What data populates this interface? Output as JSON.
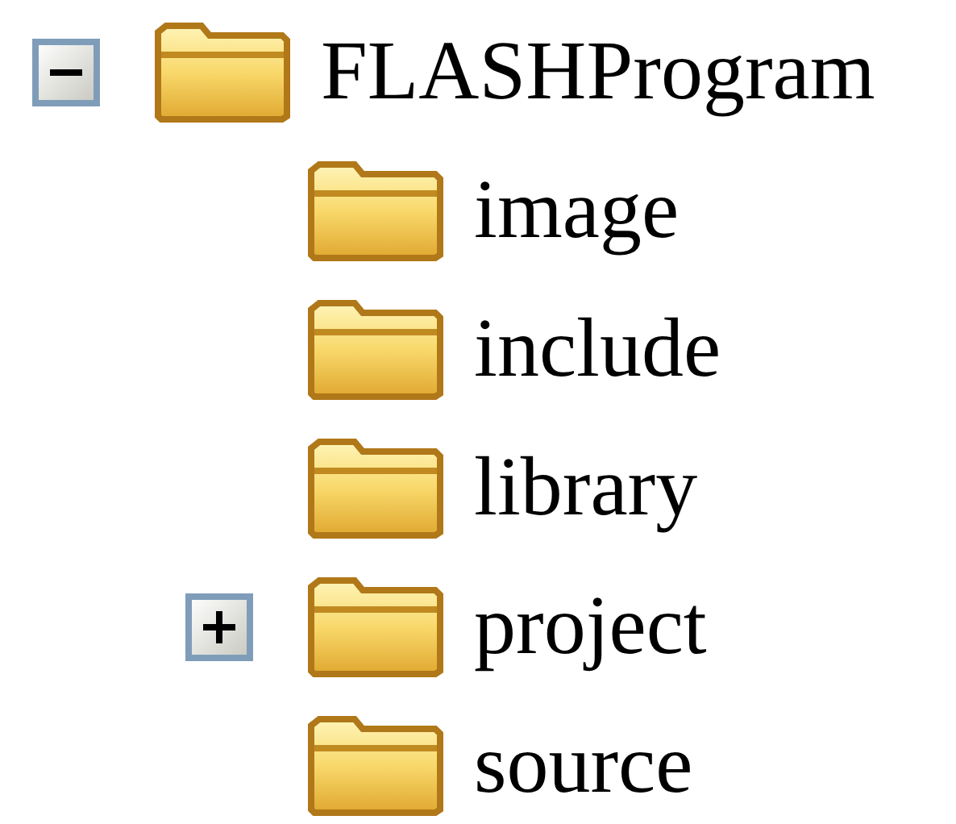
{
  "tree": [
    {
      "label": "FLASHProgram",
      "expanded": true,
      "children": [
        {
          "label": "image"
        },
        {
          "label": "include"
        },
        {
          "label": "library"
        },
        {
          "label": "project",
          "expanded": false
        },
        {
          "label": "source"
        }
      ]
    }
  ]
}
